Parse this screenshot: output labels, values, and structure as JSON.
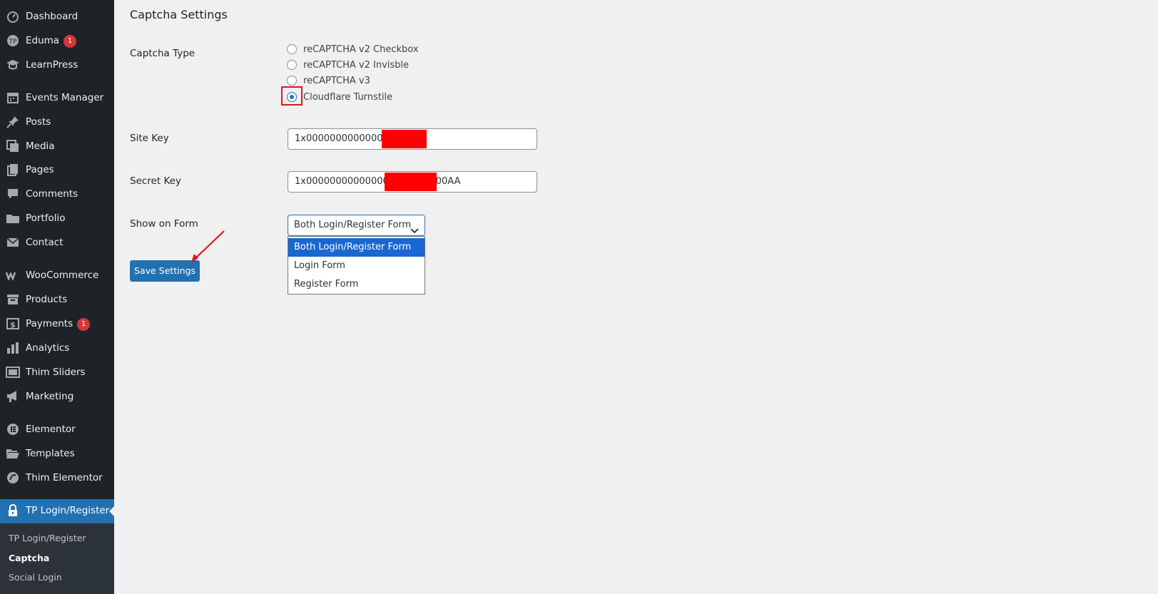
{
  "sidebar": {
    "items": [
      {
        "label": "Dashboard",
        "icon": "dashboard-icon"
      },
      {
        "label": "Eduma",
        "icon": "eduma-icon",
        "badge": "1"
      },
      {
        "label": "LearnPress",
        "icon": "graduation-cap-icon"
      },
      {
        "label": "Events Manager",
        "icon": "calendar-icon"
      },
      {
        "label": "Posts",
        "icon": "pushpin-icon"
      },
      {
        "label": "Media",
        "icon": "media-icon"
      },
      {
        "label": "Pages",
        "icon": "pages-icon"
      },
      {
        "label": "Comments",
        "icon": "comment-icon"
      },
      {
        "label": "Portfolio",
        "icon": "folder-icon"
      },
      {
        "label": "Contact",
        "icon": "envelope-icon"
      },
      {
        "label": "WooCommerce",
        "icon": "woocommerce-icon"
      },
      {
        "label": "Products",
        "icon": "archive-icon"
      },
      {
        "label": "Payments",
        "icon": "dollar-icon",
        "badge": "1"
      },
      {
        "label": "Analytics",
        "icon": "bar-chart-icon"
      },
      {
        "label": "Thim Sliders",
        "icon": "slides-icon"
      },
      {
        "label": "Marketing",
        "icon": "megaphone-icon"
      },
      {
        "label": "Elementor",
        "icon": "elementor-icon"
      },
      {
        "label": "Templates",
        "icon": "folder-open-icon"
      },
      {
        "label": "Thim Elementor",
        "icon": "thim-icon"
      },
      {
        "label": "TP Login/Register",
        "icon": "lock-icon"
      }
    ],
    "submenu": [
      "TP Login/Register",
      "Captcha",
      "Social Login"
    ]
  },
  "main": {
    "title": "Captcha Settings",
    "captcha_type": {
      "label": "Captcha Type",
      "options": [
        "reCAPTCHA v2 Checkbox",
        "reCAPTCHA v2 Invisble",
        "reCAPTCHA v3",
        "Cloudflare Turnstile"
      ],
      "selected": "Cloudflare Turnstile"
    },
    "site_key": {
      "label": "Site Key",
      "value": "1x000000000000000"
    },
    "secret_key": {
      "label": "Secret Key",
      "value": "1x0000000000000000",
      "value_tail": "0000000AA"
    },
    "show_on_form": {
      "label": "Show on Form",
      "selected": "Both Login/Register Form",
      "options": [
        "Both Login/Register Form",
        "Login Form",
        "Register Form"
      ]
    },
    "save_label": "Save Settings"
  },
  "colors": {
    "sidebar_bg": "#1d2327",
    "accent": "#2271b1",
    "badge": "#d63638",
    "redaction": "#ff0000",
    "annotation": "#e0141f"
  }
}
